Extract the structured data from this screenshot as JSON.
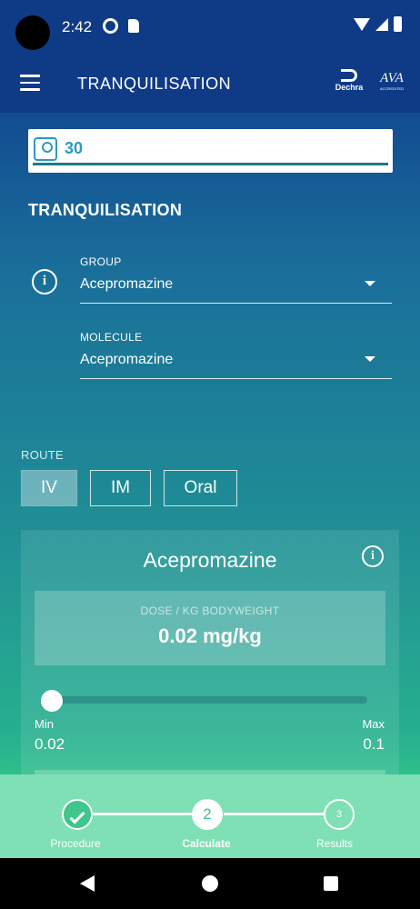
{
  "status_bar": {
    "time": "2:42"
  },
  "app_bar": {
    "title": "TRANQUILISATION",
    "logo_dechra": "Dechra",
    "logo_ava": "AVA",
    "logo_ava_sub": "ACCREDITED"
  },
  "weight": {
    "value": "30"
  },
  "section": {
    "title": "TRANQUILISATION"
  },
  "group": {
    "label": "GROUP",
    "value": "Acepromazine"
  },
  "molecule": {
    "label": "MOLECULE",
    "value": "Acepromazine"
  },
  "route": {
    "label": "ROUTE",
    "options": [
      "IV",
      "IM",
      "Oral"
    ],
    "selected": "IV"
  },
  "card": {
    "title": "Acepromazine",
    "dose_label": "DOSE / KG BODYWEIGHT",
    "dose_value": "0.02 mg/kg",
    "slider_fraction": 0.0,
    "min_label": "Min",
    "min_value": "0.02",
    "max_label": "Max",
    "max_value": "0.1"
  },
  "stepper": {
    "steps": [
      {
        "label": "Procedure",
        "state": "done"
      },
      {
        "label": "Calculate",
        "number": "2",
        "state": "current"
      },
      {
        "label": "Results",
        "number": "3",
        "state": "pending"
      }
    ]
  },
  "colors": {
    "header": "#0f3a86",
    "accent": "#2a9bbf",
    "stepper_bg": "#7ee0b4",
    "step_done": "#40c58a"
  }
}
